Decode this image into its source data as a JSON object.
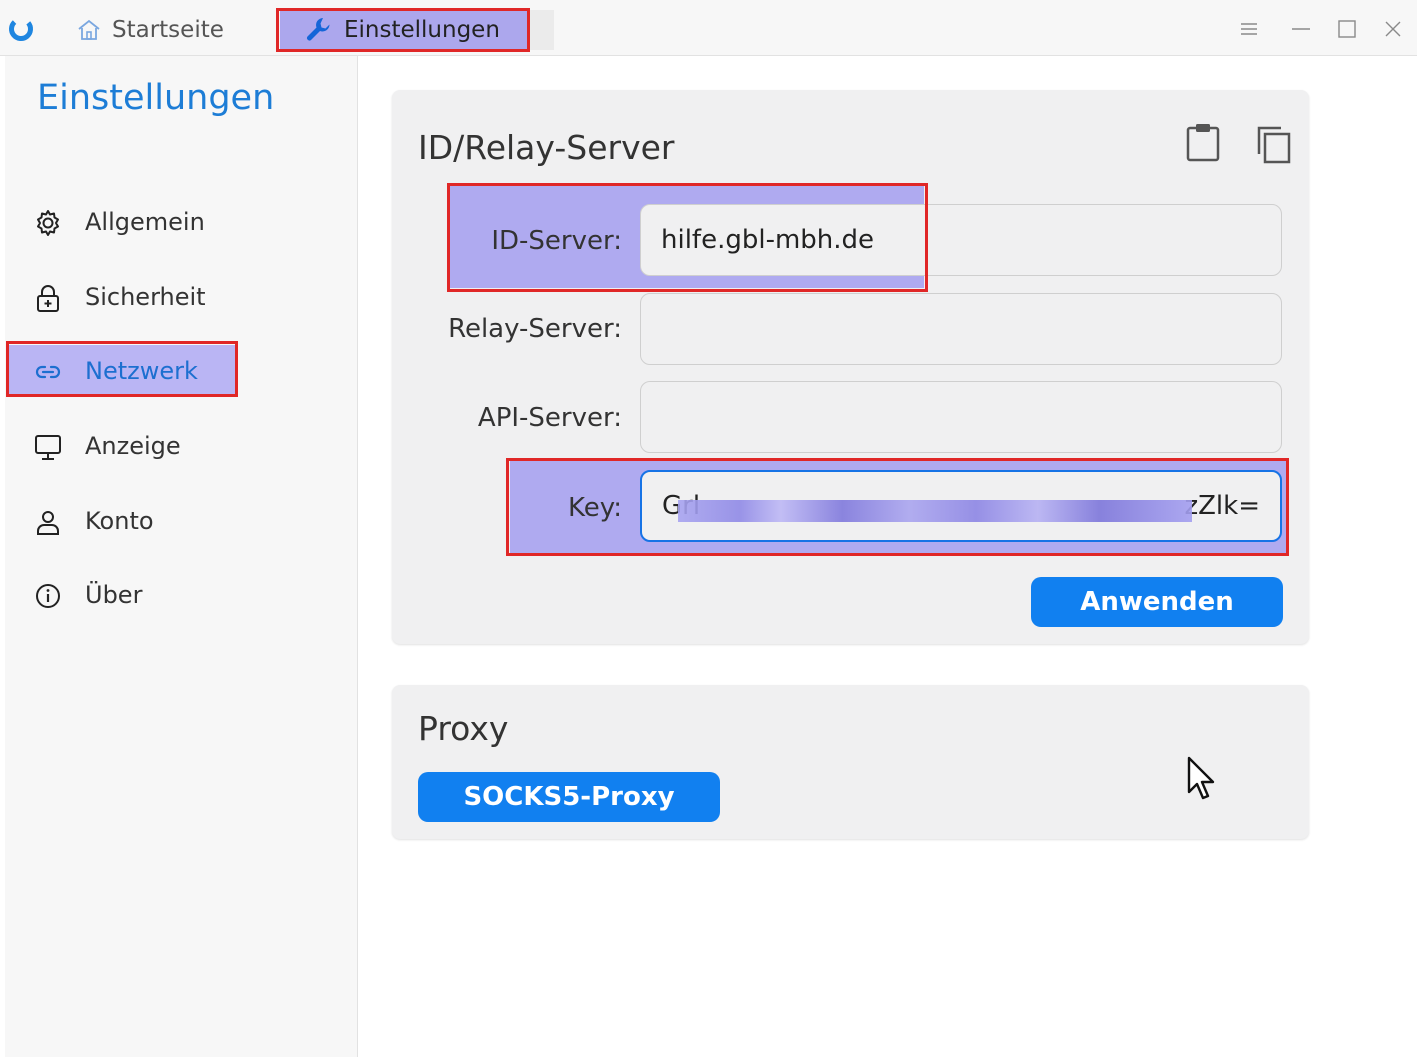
{
  "titlebar": {
    "tabs": [
      {
        "label": "Startseite",
        "icon": "home-icon"
      },
      {
        "label": "Einstellungen",
        "icon": "wrench-icon"
      }
    ],
    "controls": [
      "menu-icon",
      "minimize-icon",
      "maximize-icon",
      "close-icon"
    ]
  },
  "sidebar": {
    "title": "Einstellungen",
    "items": [
      {
        "label": "Allgemein",
        "icon": "gear-icon"
      },
      {
        "label": "Sicherheit",
        "icon": "lock-icon"
      },
      {
        "label": "Netzwerk",
        "icon": "link-icon",
        "active": true
      },
      {
        "label": "Anzeige",
        "icon": "monitor-icon"
      },
      {
        "label": "Konto",
        "icon": "user-icon"
      },
      {
        "label": "Über",
        "icon": "info-icon"
      }
    ]
  },
  "relay": {
    "title": "ID/Relay-Server",
    "fields": [
      {
        "label": "ID-Server:",
        "value": "hilfe.gbl-mbh.de"
      },
      {
        "label": "Relay-Server:",
        "value": ""
      },
      {
        "label": "API-Server:",
        "value": ""
      },
      {
        "label": "Key:",
        "value_start": "Grl",
        "value_end": "zZlk="
      }
    ],
    "apply_label": "Anwenden"
  },
  "proxy": {
    "title": "Proxy",
    "socks_label": "SOCKS5-Proxy"
  },
  "colors": {
    "accent": "#1180f0",
    "sidebar_title": "#1d7dd6",
    "highlight": "#6e64f0",
    "annotation_red": "#e02727"
  }
}
